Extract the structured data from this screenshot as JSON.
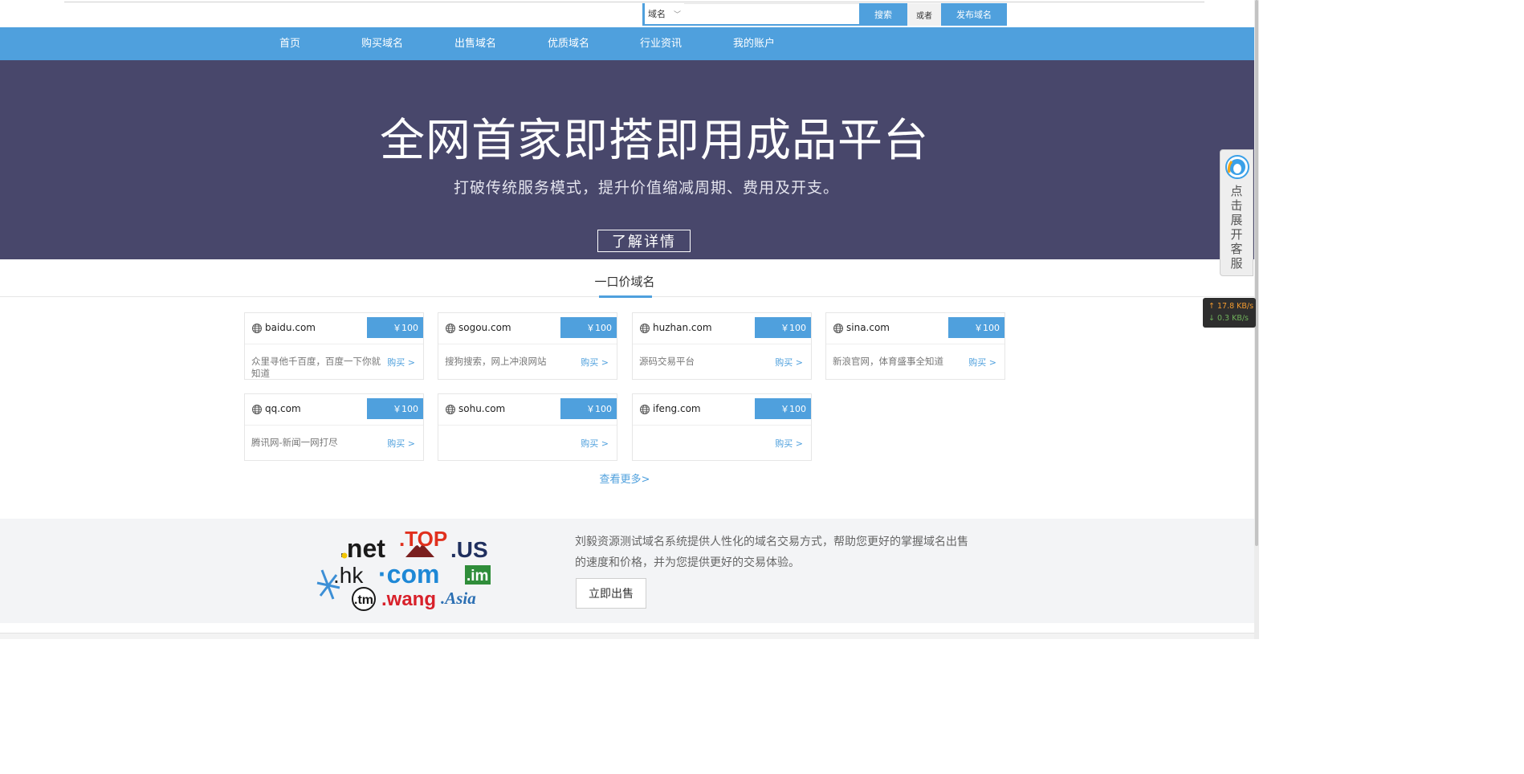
{
  "search": {
    "type_label": "域名",
    "input_value": "",
    "search_label": "搜索",
    "or_label": "或者",
    "publish_label": "发布域名"
  },
  "nav": {
    "items": [
      {
        "label": "首页"
      },
      {
        "label": "购买域名"
      },
      {
        "label": "出售域名"
      },
      {
        "label": "优质域名"
      },
      {
        "label": "行业资讯"
      },
      {
        "label": "我的账户"
      }
    ]
  },
  "hero": {
    "title": "全网首家即搭即用成品平台",
    "subtitle": "打破传统服务模式，提升价值缩减周期、费用及开支。",
    "button_label": "了解详情"
  },
  "section": {
    "title": "一口价域名",
    "view_more": "查看更多>"
  },
  "domains": [
    {
      "name": "baidu.com",
      "price": "￥100",
      "desc": "众里寻他千百度，百度一下你就知道",
      "buy": "购买 >"
    },
    {
      "name": "sogou.com",
      "price": "￥100",
      "desc": "搜狗搜索，网上冲浪网站",
      "buy": "购买 >"
    },
    {
      "name": "huzhan.com",
      "price": "￥100",
      "desc": "源码交易平台",
      "buy": "购买 >"
    },
    {
      "name": "sina.com",
      "price": "￥100",
      "desc": "新浪官网，体育盛事全知道",
      "buy": "购买 >"
    },
    {
      "name": "qq.com",
      "price": "￥100",
      "desc": "腾讯网-新闻一网打尽",
      "buy": "购买 >"
    },
    {
      "name": "sohu.com",
      "price": "￥100",
      "desc": "",
      "buy": "购买 >"
    },
    {
      "name": "ifeng.com",
      "price": "￥100",
      "desc": "",
      "buy": "购买 >"
    }
  ],
  "bottom": {
    "logos": {
      "net": ".net",
      "top": ".TOP",
      "us": ".US",
      "hk": ".hk",
      "com": "·com",
      "im": ".im",
      "tm": ".tm",
      "wang": ".wang",
      "asia": ".Asia"
    },
    "text": "刘毅资源测试域名系统提供人性化的域名交易方式，帮助您更好的掌握域名出售的速度和价格，并为您提供更好的交易体验。",
    "sell_label": "立即出售"
  },
  "sidebar": {
    "cs_text": "点击展开客服",
    "speed_up": "↑ 17.8 KB/s",
    "speed_down": "↓ 0.3 KB/s"
  },
  "colors": {
    "accent": "#4fa0dd",
    "hero_bg": "#48476b",
    "band_bg": "#f3f4f6"
  }
}
